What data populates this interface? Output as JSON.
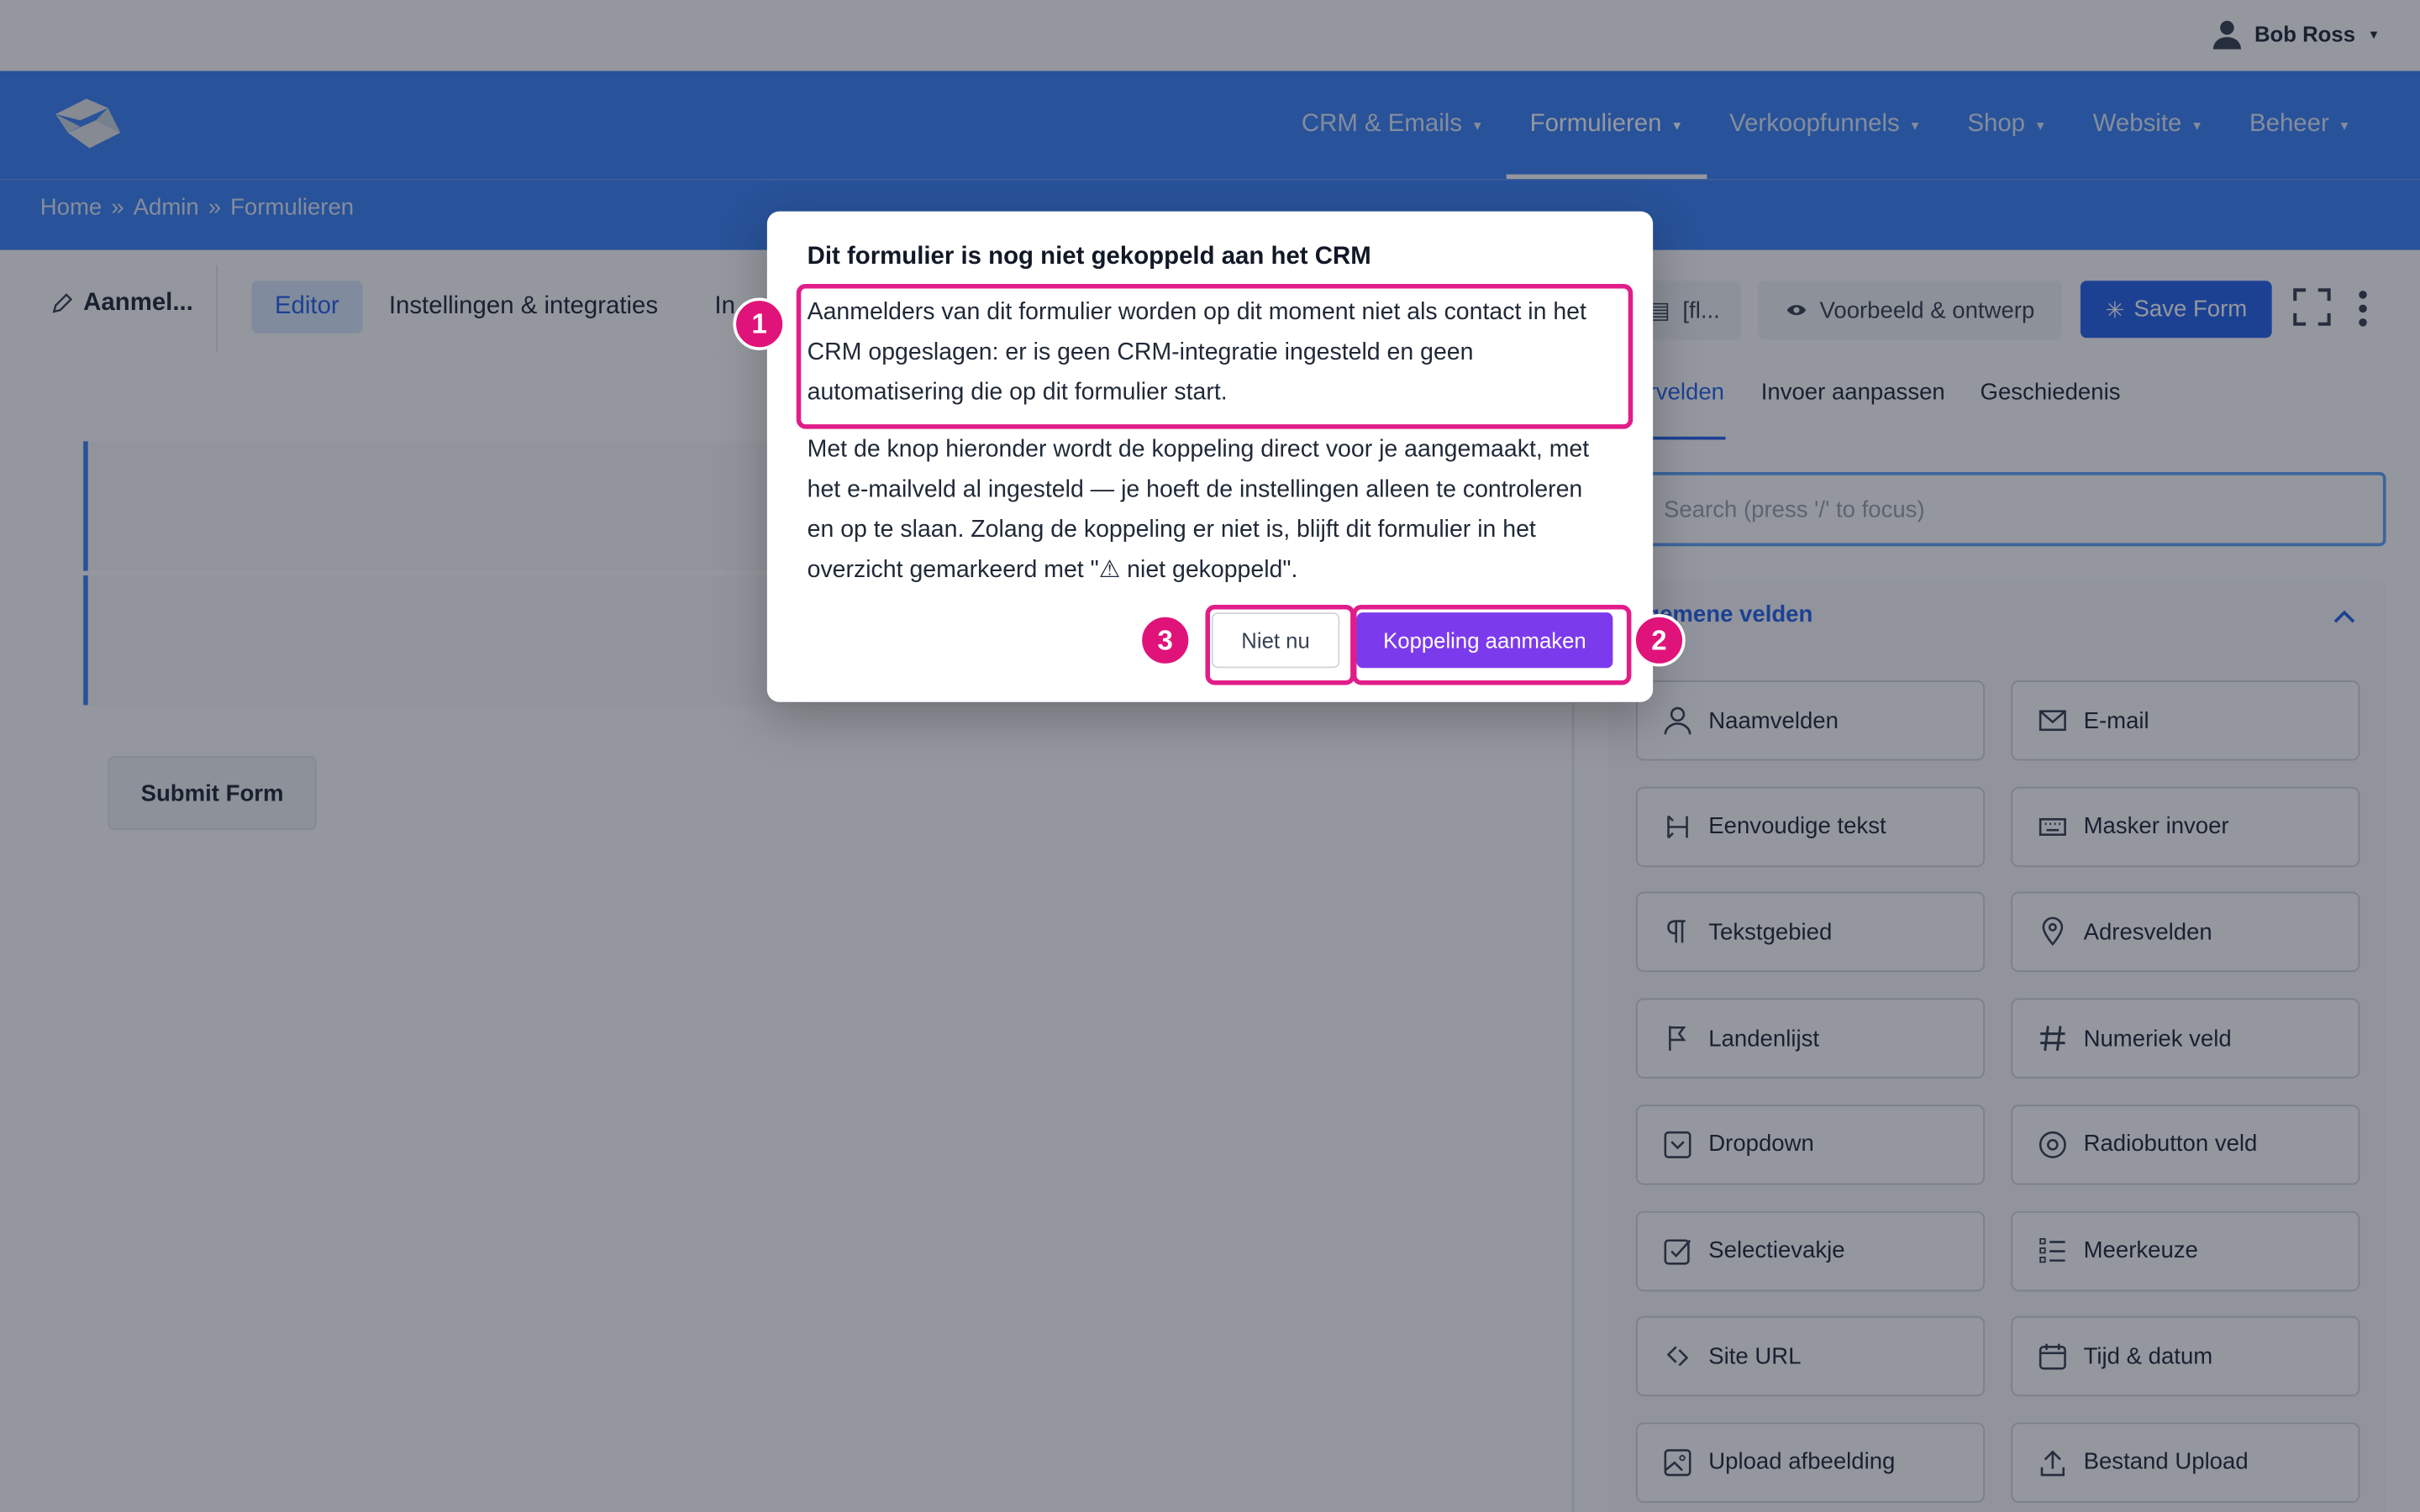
{
  "user": {
    "name": "Bob Ross"
  },
  "nav": {
    "items": [
      "CRM & Emails",
      "Formulieren",
      "Verkoopfunnels",
      "Shop",
      "Website",
      "Beheer"
    ],
    "active": "Formulieren"
  },
  "breadcrumb": [
    "Home",
    "»",
    "Admin",
    "»",
    "Formulieren"
  ],
  "toolbar": {
    "form_name": "Aanmel...",
    "tabs": [
      "Editor",
      "Instellingen & integraties",
      "In"
    ],
    "shortcode": "[fl...",
    "preview": "Voorbeeld & ontwerp",
    "save": "Save Form"
  },
  "canvas": {
    "submit_label": "Submit Form"
  },
  "panel": {
    "tabs": [
      "rvelden",
      "Invoer aanpassen",
      "Geschiedenis"
    ],
    "search_placeholder": "Search (press '/' to focus)",
    "section_title": "lgemene velden",
    "fields": [
      {
        "label": "Naamvelden",
        "icon": "user-icon"
      },
      {
        "label": "E-mail",
        "icon": "envelope-icon"
      },
      {
        "label": "Eenvoudige tekst",
        "icon": "text-cursor-icon"
      },
      {
        "label": "Masker invoer",
        "icon": "keyboard-icon"
      },
      {
        "label": "Tekstgebied",
        "icon": "paragraph-icon"
      },
      {
        "label": "Adresvelden",
        "icon": "map-pin-icon"
      },
      {
        "label": "Landenlijst",
        "icon": "flag-icon"
      },
      {
        "label": "Numeriek veld",
        "icon": "hash-icon"
      },
      {
        "label": "Dropdown",
        "icon": "dropdown-icon"
      },
      {
        "label": "Radiobutton veld",
        "icon": "radio-icon"
      },
      {
        "label": "Selectievakje",
        "icon": "checkbox-icon"
      },
      {
        "label": "Meerkeuze",
        "icon": "list-icon"
      },
      {
        "label": "Site URL",
        "icon": "link-icon"
      },
      {
        "label": "Tijd & datum",
        "icon": "calendar-icon"
      },
      {
        "label": "Upload afbeelding",
        "icon": "image-icon"
      },
      {
        "label": "Bestand Upload",
        "icon": "upload-icon"
      }
    ]
  },
  "modal": {
    "title": "Dit formulier is nog niet gekoppeld aan het CRM",
    "paragraph1": "Aanmelders van dit formulier worden op dit moment niet als contact in het CRM opgeslagen: er is geen CRM-integratie ingesteld en geen automatisering die op dit formulier start.",
    "paragraph2": "Met de knop hieronder wordt de koppeling direct voor je aangemaakt, met het e-mailveld al ingesteld — je hoeft de instellingen alleen te controleren en op te slaan. Zolang de koppeling er niet is, blijft dit formulier in het overzicht gemarkeerd met \"⚠ niet gekoppeld\".",
    "cancel": "Niet nu",
    "confirm": "Koppeling aanmaken"
  },
  "markers": [
    "1",
    "2",
    "3"
  ],
  "colors": {
    "nav": "#3b82f6",
    "primary": "#2563eb",
    "confirm": "#7c3aed",
    "highlight": "#e11d8a"
  }
}
